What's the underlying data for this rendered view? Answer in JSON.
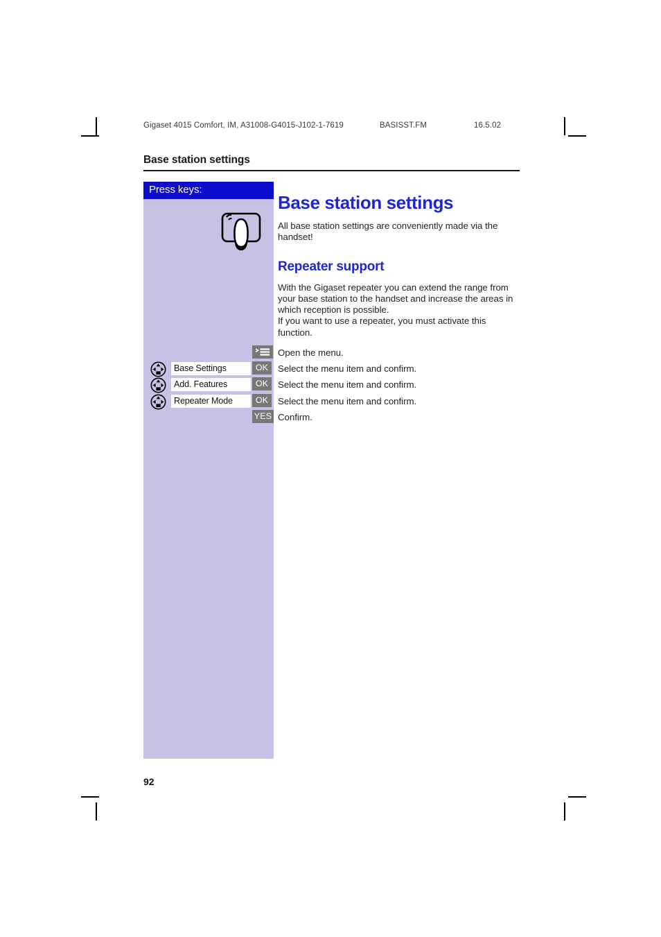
{
  "print_header": {
    "document": "Gigaset 4015 Comfort, IM, A31008-G4015-J102-1-7619",
    "file": "BASISST.FM",
    "date": "16.5.02"
  },
  "running_head": "Base station settings",
  "sidebar": {
    "title": "Press keys:",
    "press_icon_name": "thumb-press-key-icon",
    "rows": [
      {
        "nav": false,
        "label": null,
        "softkey": null,
        "key_icon": "menu-list-icon"
      },
      {
        "nav": true,
        "label": "Base Settings",
        "softkey": "OK",
        "key_icon": null
      },
      {
        "nav": true,
        "label": "Add. Features",
        "softkey": "OK",
        "key_icon": null
      },
      {
        "nav": true,
        "label": "Repeater Mode",
        "softkey": "OK",
        "key_icon": null
      },
      {
        "nav": false,
        "label": null,
        "softkey": "YES",
        "key_icon": null
      }
    ]
  },
  "main": {
    "title": "Base station settings",
    "intro": "All base station settings are conveniently made via the handset!",
    "section_title": "Repeater support",
    "section_body_1": "With the Gigaset repeater you can extend the range from your base station to the handset and increase the areas in which reception is possible.",
    "section_body_2": "If you want to use a repeater, you must activate this function."
  },
  "instructions": [
    "Open the menu.",
    "Select the menu item and confirm.",
    "Select the menu item and confirm.",
    "Select the menu item and confirm.",
    "Confirm."
  ],
  "folio": "92",
  "colors": {
    "heading_blue": "#2026cf",
    "title_bar_blue": "#0c0ccd",
    "panel_lavender": "#c7c1e6",
    "softkey_gray": "#787878"
  }
}
